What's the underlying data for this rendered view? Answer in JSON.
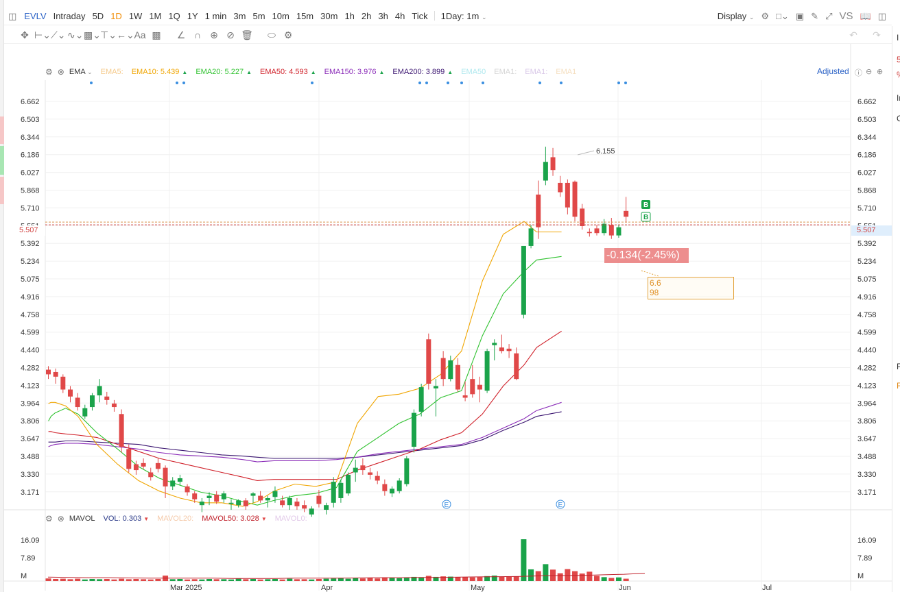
{
  "topbar": {
    "symbol": "EVLV",
    "periods": [
      "Intraday",
      "5D",
      "1D",
      "1W",
      "1M",
      "1Q",
      "1Y",
      "1 min",
      "3m",
      "5m",
      "10m",
      "15m",
      "30m",
      "1h",
      "2h",
      "3h",
      "4h",
      "Tick"
    ],
    "active_period": "1D",
    "interval_select": "1Day: 1m",
    "display_label": "Display",
    "vs_label": "VS"
  },
  "indicator_legend": {
    "name": "EMA",
    "items": [
      {
        "label": "EMA5:",
        "value": "",
        "color": "#f5c98a",
        "faded": true
      },
      {
        "label": "EMA10:",
        "value": "5.439",
        "color": "#f0a500"
      },
      {
        "label": "EMA20:",
        "value": "5.227",
        "color": "#2fc22f"
      },
      {
        "label": "EMA50:",
        "value": "4.593",
        "color": "#d0212a"
      },
      {
        "label": "EMA150:",
        "value": "3.976",
        "color": "#8a2bb8"
      },
      {
        "label": "EMA200:",
        "value": "3.899",
        "color": "#3a1470"
      },
      {
        "label": "EMA50",
        "value": "",
        "color": "#aee8ee",
        "faded": true
      },
      {
        "label": "EMA1:",
        "value": "",
        "color": "#d5d5d5",
        "faded": true
      },
      {
        "label": "EMA1:",
        "value": "",
        "color": "#d9c8e8",
        "faded": true
      },
      {
        "label": "EMA1",
        "value": "",
        "color": "#f5dfc0",
        "faded": true
      }
    ],
    "adjusted_label": "Adjusted"
  },
  "volume_legend": {
    "name": "MAVOL",
    "vol_label": "VOL:",
    "vol_value": "0.303",
    "mavol20_label": "MAVOL20:",
    "mavol50_label": "MAVOL50:",
    "mavol50_value": "3.028",
    "mavol0_label": "MAVOL0:"
  },
  "price_axis": {
    "ticks": [
      "6.662",
      "6.503",
      "6.344",
      "6.186",
      "6.027",
      "5.868",
      "5.710",
      "5.551",
      "5.392",
      "5.234",
      "5.075",
      "4.916",
      "4.758",
      "4.599",
      "4.440",
      "4.282",
      "4.123",
      "3.964",
      "3.806",
      "3.647",
      "3.488",
      "3.330",
      "3.171"
    ],
    "current_price": "5.507"
  },
  "volume_axis": {
    "ticks": [
      "16.09",
      "7.89",
      "M"
    ]
  },
  "time_axis": {
    "labels": [
      "Mar 2025",
      "Apr",
      "May",
      "Jun",
      "Jul"
    ]
  },
  "annotations": {
    "high_label": "6.155",
    "change_text": "-0.134(-2.45%)",
    "note_line1": "6.6",
    "note_line2": "98",
    "b_marker": "B",
    "e_marker": "E"
  },
  "right_edge": {
    "chars": [
      "I",
      "5",
      "%",
      "In",
      "C",
      "F",
      "F"
    ]
  },
  "chart_data": {
    "type": "candlestick",
    "ylim": [
      3.06,
      6.74
    ],
    "bull_color": "#1aa34a",
    "bear_color": "#e04848",
    "candles": [
      [
        4.26,
        4.29,
        4.18,
        4.22
      ],
      [
        4.24,
        4.27,
        4.14,
        4.2
      ],
      [
        4.2,
        4.22,
        4.06,
        4.09
      ],
      [
        4.09,
        4.12,
        3.98,
        4.03
      ],
      [
        4.02,
        4.06,
        3.91,
        3.94
      ],
      [
        3.86,
        3.96,
        3.84,
        3.93
      ],
      [
        3.94,
        4.06,
        3.91,
        4.04
      ],
      [
        4.04,
        4.18,
        3.98,
        4.12
      ],
      [
        4.03,
        4.07,
        3.96,
        4.0
      ],
      [
        3.97,
        4.0,
        3.9,
        3.94
      ],
      [
        3.88,
        3.92,
        3.55,
        3.6
      ],
      [
        3.58,
        3.62,
        3.38,
        3.41
      ],
      [
        3.45,
        3.48,
        3.36,
        3.4
      ],
      [
        3.46,
        3.5,
        3.41,
        3.43
      ],
      [
        3.38,
        3.42,
        3.31,
        3.34
      ],
      [
        3.46,
        3.5,
        3.38,
        3.41
      ],
      [
        3.42,
        3.44,
        3.16,
        3.26
      ],
      [
        3.26,
        3.34,
        3.23,
        3.31
      ],
      [
        3.3,
        3.36,
        3.27,
        3.33
      ],
      [
        3.26,
        3.28,
        3.18,
        3.21
      ],
      [
        3.2,
        3.22,
        3.12,
        3.15
      ],
      [
        3.1,
        3.16,
        3.04,
        3.13
      ],
      [
        3.16,
        3.21,
        3.1,
        3.18
      ],
      [
        3.19,
        3.22,
        3.11,
        3.13
      ],
      [
        3.15,
        3.22,
        3.12,
        3.2
      ],
      [
        3.11,
        3.15,
        3.06,
        3.12
      ],
      [
        3.1,
        3.15,
        3.08,
        3.14
      ],
      [
        3.14,
        3.16,
        3.06,
        3.09
      ],
      [
        3.18,
        3.21,
        3.12,
        3.2
      ],
      [
        3.18,
        3.22,
        3.12,
        3.14
      ],
      [
        3.14,
        3.18,
        3.08,
        3.16
      ],
      [
        3.17,
        3.26,
        3.12,
        3.22
      ],
      [
        3.14,
        3.18,
        3.08,
        3.1
      ],
      [
        3.1,
        3.18,
        3.06,
        3.16
      ],
      [
        3.13,
        3.16,
        3.06,
        3.09
      ],
      [
        3.1,
        3.14,
        3.04,
        3.07
      ],
      [
        3.02,
        3.09,
        3.0,
        3.07
      ],
      [
        3.18,
        3.23,
        3.08,
        3.11
      ],
      [
        3.06,
        3.12,
        3.02,
        3.1
      ],
      [
        3.12,
        3.34,
        3.08,
        3.3
      ],
      [
        3.16,
        3.32,
        3.12,
        3.29
      ],
      [
        3.2,
        3.38,
        3.18,
        3.36
      ],
      [
        3.38,
        3.49,
        3.3,
        3.42
      ],
      [
        3.44,
        3.5,
        3.36,
        3.4
      ],
      [
        3.38,
        3.42,
        3.32,
        3.36
      ],
      [
        3.35,
        3.39,
        3.28,
        3.31
      ],
      [
        3.28,
        3.32,
        3.18,
        3.22
      ],
      [
        3.2,
        3.26,
        3.17,
        3.24
      ],
      [
        3.22,
        3.33,
        3.2,
        3.31
      ],
      [
        3.28,
        3.52,
        3.26,
        3.5
      ],
      [
        3.6,
        3.92,
        3.55,
        3.89
      ],
      [
        3.9,
        4.14,
        3.86,
        4.11
      ],
      [
        4.52,
        4.57,
        4.09,
        4.14
      ],
      [
        4.1,
        4.18,
        3.86,
        4.12
      ],
      [
        4.36,
        4.42,
        4.12,
        4.18
      ],
      [
        4.18,
        4.38,
        4.16,
        4.34
      ],
      [
        4.3,
        4.36,
        4.07,
        4.09
      ],
      [
        4.04,
        4.16,
        3.99,
        4.02
      ],
      [
        4.18,
        4.3,
        4.02,
        4.05
      ],
      [
        4.13,
        4.2,
        3.98,
        4.09
      ],
      [
        4.08,
        4.44,
        4.06,
        4.42
      ],
      [
        4.47,
        4.52,
        4.34,
        4.49
      ],
      [
        4.45,
        4.56,
        4.4,
        4.42
      ],
      [
        4.44,
        4.48,
        4.36,
        4.42
      ],
      [
        4.4,
        4.45,
        4.17,
        4.18
      ],
      [
        4.73,
        5.24,
        4.7,
        5.32
      ],
      [
        5.32,
        5.5,
        5.3,
        5.47
      ],
      [
        5.76,
        5.88,
        5.38,
        5.48
      ],
      [
        5.88,
        6.17,
        5.84,
        6.04
      ],
      [
        6.08,
        6.16,
        5.92,
        5.97
      ],
      [
        5.86,
        5.92,
        5.74,
        5.78
      ],
      [
        5.86,
        5.89,
        5.59,
        5.65
      ],
      [
        5.87,
        5.88,
        5.53,
        5.57
      ],
      [
        5.64,
        5.68,
        5.46,
        5.49
      ],
      [
        5.44,
        5.47,
        5.4,
        5.43
      ],
      [
        5.47,
        5.5,
        5.41,
        5.43
      ],
      [
        5.43,
        5.55,
        5.41,
        5.51
      ],
      [
        5.5,
        5.56,
        5.38,
        5.41
      ],
      [
        5.41,
        5.5,
        5.39,
        5.48
      ],
      [
        5.62,
        5.74,
        5.52,
        5.57
      ]
    ],
    "ema10": [
      [
        4.18,
        3.97
      ],
      [
        4.3,
        3.98
      ],
      [
        4.5,
        3.98
      ],
      [
        5.0,
        3.95
      ],
      [
        5.6,
        3.86
      ],
      [
        6.5,
        3.62
      ],
      [
        7.5,
        3.45
      ],
      [
        8.5,
        3.31
      ],
      [
        9.5,
        3.22
      ],
      [
        10.5,
        3.16
      ],
      [
        11.5,
        3.12
      ],
      [
        12.5,
        3.12
      ],
      [
        13.5,
        3.09
      ],
      [
        14.2,
        3.13
      ],
      [
        15.0,
        3.22
      ],
      [
        16.0,
        3.28
      ],
      [
        17.0,
        3.26
      ],
      [
        18.0,
        3.3
      ],
      [
        19.0,
        3.8
      ],
      [
        20.0,
        4.03
      ],
      [
        21.0,
        4.05
      ],
      [
        22.0,
        4.1
      ],
      [
        23.0,
        4.22
      ],
      [
        24.0,
        4.42
      ],
      [
        25.0,
        5.02
      ],
      [
        26.0,
        5.42
      ],
      [
        27.0,
        5.53
      ],
      [
        27.6,
        5.44
      ],
      [
        28.8,
        5.44
      ]
    ],
    "ema20": [
      [
        4.18,
        3.82
      ],
      [
        4.3,
        3.86
      ],
      [
        4.5,
        3.89
      ],
      [
        5.0,
        3.93
      ],
      [
        5.6,
        3.88
      ],
      [
        6.5,
        3.72
      ],
      [
        7.5,
        3.58
      ],
      [
        8.5,
        3.43
      ],
      [
        9.5,
        3.33
      ],
      [
        10.5,
        3.27
      ],
      [
        11.5,
        3.21
      ],
      [
        12.5,
        3.18
      ],
      [
        13.5,
        3.13
      ],
      [
        14.2,
        3.1
      ],
      [
        15.0,
        3.14
      ],
      [
        16.0,
        3.18
      ],
      [
        17.0,
        3.2
      ],
      [
        18.0,
        3.25
      ],
      [
        19.0,
        3.56
      ],
      [
        20.0,
        3.68
      ],
      [
        21.0,
        3.8
      ],
      [
        22.0,
        3.88
      ],
      [
        23.0,
        4.02
      ],
      [
        24.0,
        4.08
      ],
      [
        25.0,
        4.55
      ],
      [
        26.0,
        4.91
      ],
      [
        27.0,
        5.1
      ],
      [
        27.6,
        5.2
      ],
      [
        28.8,
        5.23
      ]
    ],
    "ema50": [
      [
        4.18,
        3.73
      ],
      [
        4.3,
        3.73
      ],
      [
        4.5,
        3.72
      ],
      [
        5.0,
        3.71
      ],
      [
        5.6,
        3.7
      ],
      [
        6.5,
        3.68
      ],
      [
        7.5,
        3.62
      ],
      [
        8.5,
        3.56
      ],
      [
        9.5,
        3.5
      ],
      [
        10.5,
        3.46
      ],
      [
        11.5,
        3.42
      ],
      [
        12.5,
        3.38
      ],
      [
        13.5,
        3.34
      ],
      [
        14.2,
        3.31
      ],
      [
        15.0,
        3.32
      ],
      [
        16.0,
        3.32
      ],
      [
        17.0,
        3.32
      ],
      [
        18.0,
        3.32
      ],
      [
        19.0,
        3.4
      ],
      [
        20.0,
        3.46
      ],
      [
        21.0,
        3.52
      ],
      [
        22.0,
        3.58
      ],
      [
        23.0,
        3.66
      ],
      [
        24.0,
        3.72
      ],
      [
        25.0,
        3.88
      ],
      [
        26.0,
        4.12
      ],
      [
        27.0,
        4.3
      ],
      [
        27.6,
        4.45
      ],
      [
        28.8,
        4.59
      ]
    ],
    "ema150": [
      [
        4.18,
        3.6
      ],
      [
        4.3,
        3.61
      ],
      [
        4.5,
        3.62
      ],
      [
        5.0,
        3.63
      ],
      [
        5.6,
        3.63
      ],
      [
        6.5,
        3.62
      ],
      [
        7.5,
        3.6
      ],
      [
        8.5,
        3.58
      ],
      [
        9.5,
        3.55
      ],
      [
        10.5,
        3.53
      ],
      [
        11.5,
        3.52
      ],
      [
        12.5,
        3.51
      ],
      [
        13.5,
        3.49
      ],
      [
        14.2,
        3.47
      ],
      [
        15.0,
        3.48
      ],
      [
        16.0,
        3.48
      ],
      [
        17.0,
        3.48
      ],
      [
        18.0,
        3.49
      ],
      [
        19.0,
        3.51
      ],
      [
        20.0,
        3.54
      ],
      [
        21.0,
        3.56
      ],
      [
        22.0,
        3.58
      ],
      [
        23.0,
        3.6
      ],
      [
        24.0,
        3.62
      ],
      [
        25.0,
        3.68
      ],
      [
        26.0,
        3.76
      ],
      [
        27.0,
        3.84
      ],
      [
        27.6,
        3.91
      ],
      [
        28.8,
        3.98
      ]
    ],
    "ema200": [
      [
        4.18,
        3.64
      ],
      [
        4.3,
        3.64
      ],
      [
        4.5,
        3.64
      ],
      [
        5.0,
        3.65
      ],
      [
        5.6,
        3.65
      ],
      [
        6.5,
        3.64
      ],
      [
        7.5,
        3.63
      ],
      [
        8.5,
        3.62
      ],
      [
        9.5,
        3.59
      ],
      [
        10.5,
        3.57
      ],
      [
        11.5,
        3.55
      ],
      [
        12.5,
        3.53
      ],
      [
        13.5,
        3.52
      ],
      [
        14.2,
        3.51
      ],
      [
        15.0,
        3.5
      ],
      [
        16.0,
        3.5
      ],
      [
        17.0,
        3.5
      ],
      [
        18.0,
        3.5
      ],
      [
        19.0,
        3.51
      ],
      [
        20.0,
        3.53
      ],
      [
        21.0,
        3.55
      ],
      [
        22.0,
        3.57
      ],
      [
        23.0,
        3.59
      ],
      [
        24.0,
        3.61
      ],
      [
        25.0,
        3.66
      ],
      [
        26.0,
        3.74
      ],
      [
        27.0,
        3.81
      ],
      [
        27.6,
        3.86
      ],
      [
        28.8,
        3.9
      ]
    ],
    "volume": [
      1.0,
      0.8,
      0.9,
      0.7,
      0.9,
      0.6,
      0.8,
      0.7,
      0.8,
      0.6,
      0.9,
      0.7,
      0.8,
      0.7,
      0.6,
      0.8,
      2.1,
      0.7,
      0.8,
      0.6,
      0.7,
      0.6,
      0.8,
      0.7,
      0.7,
      0.6,
      0.9,
      0.7,
      0.8,
      0.6,
      0.7,
      0.8,
      0.6,
      0.9,
      0.7,
      0.7,
      0.6,
      0.8,
      0.9,
      1.0,
      1.1,
      0.9,
      1.2,
      1.0,
      1.3,
      1.0,
      1.4,
      1.2,
      1.1,
      1.3,
      1.6,
      1.4,
      2.0,
      1.6,
      1.8,
      1.7,
      1.5,
      1.6,
      1.4,
      1.5,
      1.9,
      2.1,
      1.7,
      1.6,
      1.8,
      16.09,
      4.5,
      3.8,
      6.5,
      4.4,
      3.0,
      4.6,
      3.8,
      2.9,
      3.6,
      2.0,
      1.5,
      1.2,
      1.4,
      0.9
    ],
    "mavol50": [
      1.5,
      1.4,
      1.3,
      1.3,
      1.2,
      1.1,
      1.1,
      1.1,
      1.1,
      1.0,
      1.0,
      1.0,
      1.1,
      1.1,
      1.1,
      1.2,
      1.3,
      1.3,
      1.4,
      1.4,
      1.5,
      1.6,
      1.7,
      1.8,
      2.0,
      2.1,
      2.2,
      2.4,
      2.6,
      3.0
    ]
  }
}
